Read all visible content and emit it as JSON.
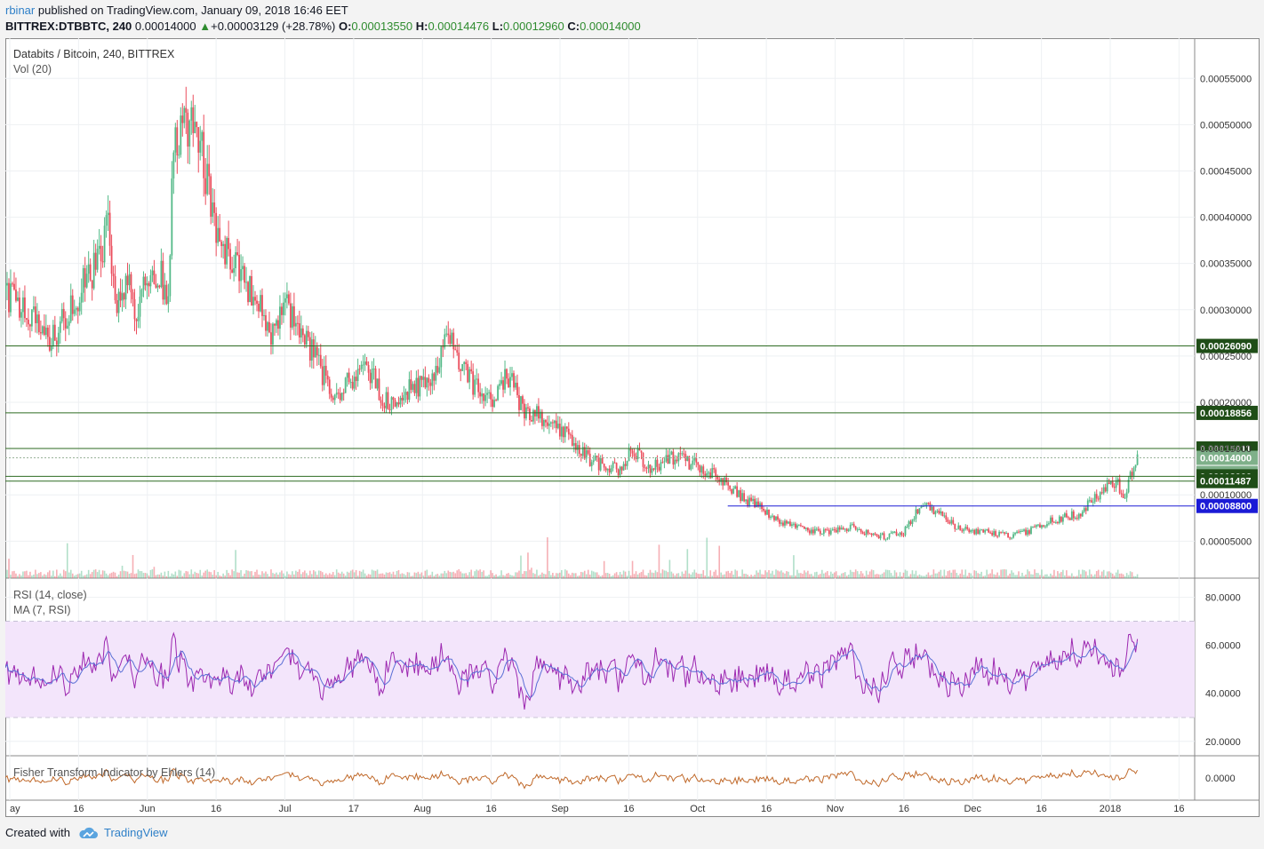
{
  "header": {
    "author": "rbinar",
    "published_text": "published on TradingView.com, January 09, 2018 16:46 EET",
    "symbol": "BITTREX:DTBBTC, 240",
    "last": "0.00014000",
    "change": "+0.00003129 (+28.78%)",
    "o_label": "O:",
    "o": "0.00013550",
    "h_label": "H:",
    "h": "0.00014476",
    "l_label": "L:",
    "l": "0.00012960",
    "c_label": "C:",
    "c": "0.00014000"
  },
  "main_pane": {
    "title": "Databits / Bitcoin, 240, BITTREX",
    "vol_label": "Vol (20)"
  },
  "rsi_pane": {
    "title": "RSI (14, close)",
    "ma_label": "MA (7, RSI)"
  },
  "fisher_pane": {
    "title": "Fisher Transform Indicator by Ehlers (14)"
  },
  "footer": {
    "created_with": "Created with",
    "brand": "TradingView"
  },
  "colors": {
    "up": "#53b987",
    "down": "#eb4d5c",
    "hline": "#2e6b22",
    "blue_line": "#1b1bd6",
    "rsi": "#9c27b0",
    "rsi_ma": "#5b6fd6",
    "rsi_band": "#f3e5fb",
    "fisher": "#c0692a",
    "vol_ma": "#ff8a3d"
  },
  "chart_data": [
    {
      "type": "candlestick",
      "title": "Databits / Bitcoin, 240, BITTREX",
      "x_ticks": [
        "ay",
        "16",
        "Jun",
        "16",
        "Jul",
        "17",
        "Aug",
        "16",
        "Sep",
        "16",
        "Oct",
        "16",
        "Nov",
        "16",
        "Dec",
        "16",
        "2018",
        "16"
      ],
      "y_ticks": [
        "0.00005000",
        "0.00010000",
        "0.00015000",
        "0.00020000",
        "0.00025000",
        "0.00030000",
        "0.00035000",
        "0.00040000",
        "0.00045000",
        "0.00050000",
        "0.00055000"
      ],
      "ylim": [
        1e-05,
        0.00058
      ],
      "approx_close_path": [
        [
          0,
          0.00032
        ],
        [
          0.03,
          0.00029
        ],
        [
          0.05,
          0.00027
        ],
        [
          0.07,
          0.00029
        ],
        [
          0.09,
          0.00033
        ],
        [
          0.11,
          0.00036
        ],
        [
          0.115,
          0.00043
        ],
        [
          0.125,
          0.0003
        ],
        [
          0.14,
          0.00033
        ],
        [
          0.15,
          0.00029
        ],
        [
          0.16,
          0.00033
        ],
        [
          0.175,
          0.00034
        ],
        [
          0.185,
          0.00031
        ],
        [
          0.19,
          0.00046
        ],
        [
          0.2,
          0.00049
        ],
        [
          0.215,
          0.00052
        ],
        [
          0.225,
          0.00046
        ],
        [
          0.235,
          0.0004
        ],
        [
          0.25,
          0.00036
        ],
        [
          0.27,
          0.00033
        ],
        [
          0.29,
          0.00031
        ],
        [
          0.3,
          0.00027
        ],
        [
          0.32,
          0.0003
        ],
        [
          0.34,
          0.00027
        ],
        [
          0.355,
          0.00024
        ],
        [
          0.37,
          0.00021
        ],
        [
          0.39,
          0.00022
        ],
        [
          0.41,
          0.00024
        ],
        [
          0.43,
          0.0002
        ],
        [
          0.45,
          0.00021
        ],
        [
          0.47,
          0.00022
        ],
        [
          0.49,
          0.00023
        ],
        [
          0.5,
          0.00028
        ],
        [
          0.51,
          0.00026
        ],
        [
          0.53,
          0.00022
        ],
        [
          0.55,
          0.0002
        ],
        [
          0.57,
          0.00023
        ],
        [
          0.59,
          0.00019
        ],
        [
          0.62,
          0.00018
        ],
        [
          0.64,
          0.00016
        ],
        [
          0.66,
          0.00014
        ],
        [
          0.68,
          0.00013
        ],
        [
          0.7,
          0.000125
        ],
        [
          0.71,
          0.00015
        ],
        [
          0.73,
          0.00013
        ],
        [
          0.76,
          0.00014
        ],
        [
          0.79,
          0.00013
        ],
        [
          0.82,
          0.00011
        ],
        [
          0.84,
          9.5e-05
        ],
        [
          0.86,
          8.5e-05
        ],
        [
          0.88,
          7e-05
        ],
        [
          0.9,
          6.5e-05
        ],
        [
          0.92,
          6e-05
        ],
        [
          0.94,
          6e-05
        ],
        [
          0.96,
          6.5e-05
        ],
        [
          0.98,
          5.8e-05
        ],
        [
          1.0,
          5.5e-05
        ],
        [
          1.02,
          6e-05
        ],
        [
          1.04,
          9e-05
        ],
        [
          1.06,
          8e-05
        ],
        [
          1.08,
          6.5e-05
        ],
        [
          1.1,
          6e-05
        ],
        [
          1.12,
          6e-05
        ],
        [
          1.14,
          5.5e-05
        ],
        [
          1.16,
          6e-05
        ],
        [
          1.18,
          7e-05
        ],
        [
          1.2,
          7.5e-05
        ],
        [
          1.22,
          8e-05
        ],
        [
          1.24,
          0.0001
        ],
        [
          1.26,
          0.000115
        ],
        [
          1.27,
          0.0001
        ],
        [
          1.285,
          0.00014
        ]
      ],
      "horizontal_levels": [
        {
          "value": 0.0002609,
          "label": "0.00026090",
          "style": "support-resistance"
        },
        {
          "value": 0.00018856,
          "label": "0.00018856",
          "style": "support-resistance"
        },
        {
          "value": 0.00015011,
          "label": "0.00015011",
          "style": "support-resistance"
        },
        {
          "value": 0.00014,
          "label": "0.00014000",
          "style": "last-price",
          "countdown": "01:13:10"
        },
        {
          "value": 0.00012,
          "label": "0.00012000",
          "style": "support-resistance"
        },
        {
          "value": 0.00011487,
          "label": "0.00011487",
          "style": "support-resistance"
        },
        {
          "value": 8.8e-05,
          "label": "0.00008800",
          "style": "blue-line"
        }
      ],
      "volume": {
        "label": "Vol (20)"
      }
    },
    {
      "type": "line",
      "title": "RSI (14, close)",
      "series": [
        {
          "name": "RSI (14, close)"
        },
        {
          "name": "MA (7, RSI)"
        }
      ],
      "y_ticks": [
        "20.0000",
        "40.0000",
        "60.0000",
        "80.0000"
      ],
      "ylim": [
        14,
        88
      ],
      "band": [
        30,
        70
      ]
    },
    {
      "type": "line",
      "title": "Fisher Transform Indicator by Ehlers (14)",
      "y_ticks": [
        "0.0000"
      ],
      "ylim": [
        -3,
        3
      ]
    }
  ]
}
